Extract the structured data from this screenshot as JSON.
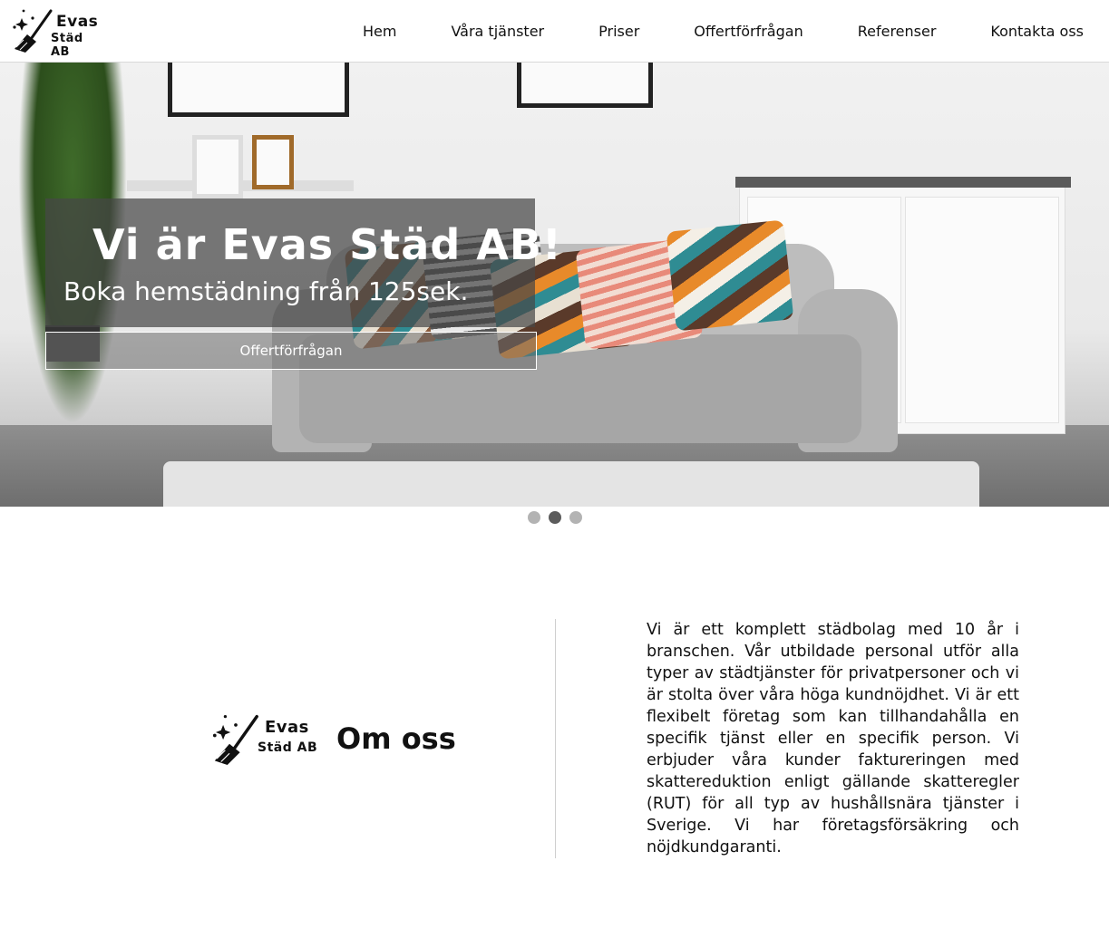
{
  "brand": {
    "logo_line1": "Evas",
    "logo_line2": "Städ AB",
    "logo_icon": "broom-icon"
  },
  "nav": {
    "items": [
      {
        "label": "Hem"
      },
      {
        "label": "Våra tjänster"
      },
      {
        "label": "Priser"
      },
      {
        "label": "Offertförfrågan"
      },
      {
        "label": "Referenser"
      },
      {
        "label": "Kontakta oss"
      }
    ]
  },
  "hero": {
    "title": "Vi är Evas Städ AB!",
    "subtitle": "Boka hemstädning från 125sek.",
    "cta_label": "Offertförfrågan"
  },
  "carousel": {
    "slide_count": 3,
    "active_index": 1
  },
  "about": {
    "heading": "Om oss",
    "text": "Vi är ett komplett städbolag med 10 år i branschen. Vår utbildade personal utför alla typer av städtjänster för privatpersoner och vi är stolta över våra höga kundnöjdhet. Vi är ett flexibelt företag som kan tillhandahålla en specifik tjänst eller en specifik person. Vi erbjuder våra kunder faktureringen med skattereduktion enligt gällande skatteregler (RUT) för all typ av hushållsnära tjänster i Sverige. Vi har företagsförsäkring och nöjdkundgaranti."
  },
  "colors": {
    "hero_overlay": "#464646",
    "dot_active": "#5c5c5c",
    "dot_inactive": "#b3b3b3"
  }
}
